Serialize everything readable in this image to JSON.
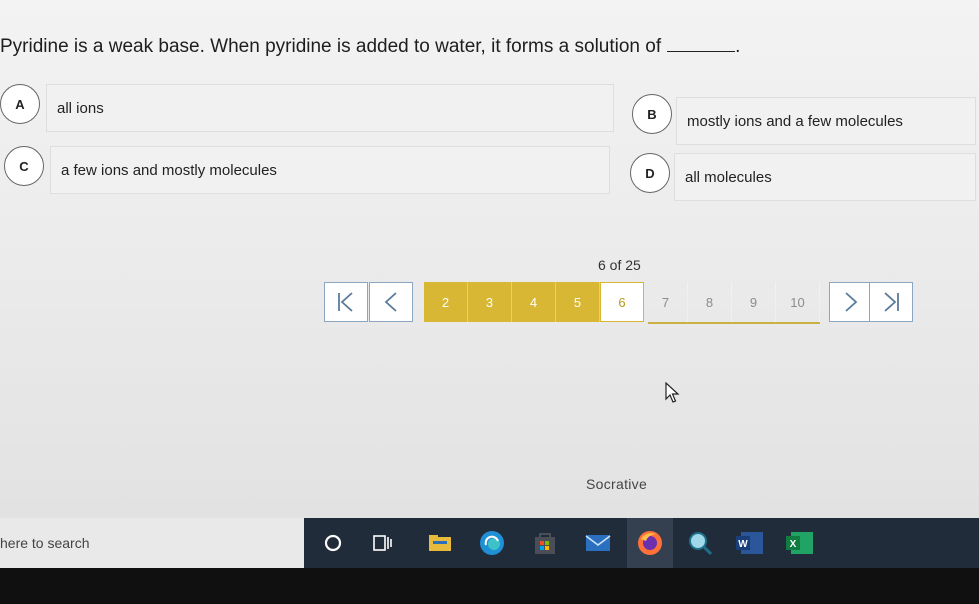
{
  "question": {
    "text": "Pyridine is a weak base. When pyridine is added to water, it forms a solution of",
    "suffix": "."
  },
  "options": [
    {
      "letter": "A",
      "text": "all ions"
    },
    {
      "letter": "B",
      "text": "mostly ions and a few molecules"
    },
    {
      "letter": "C",
      "text": "a few ions and mostly molecules"
    },
    {
      "letter": "D",
      "text": "all molecules"
    }
  ],
  "progress": {
    "text": "6 of 25",
    "current": 6,
    "total": 25
  },
  "pager": {
    "pages": [
      "2",
      "3",
      "4",
      "5",
      "6",
      "7",
      "8",
      "9",
      "10"
    ],
    "answered": [
      2,
      3,
      4,
      5
    ],
    "current": 6,
    "first_icon": "first-page-icon",
    "prev_icon": "prev-page-icon",
    "next_icon": "next-page-icon",
    "last_icon": "last-page-icon"
  },
  "footer": {
    "brand": "Socrative"
  },
  "taskbar": {
    "search_placeholder": "here to search",
    "icons": [
      "cortana-icon",
      "task-view-icon",
      "file-explorer-icon",
      "edge-icon",
      "store-icon",
      "mail-icon",
      "firefox-icon",
      "magnifier-icon",
      "word-icon",
      "excel-icon"
    ],
    "word_letter": "W",
    "excel_letter": "X"
  },
  "colors": {
    "answered": "#d7b733",
    "nav_border": "#8aa6c2",
    "taskbar": "#202c3a"
  }
}
